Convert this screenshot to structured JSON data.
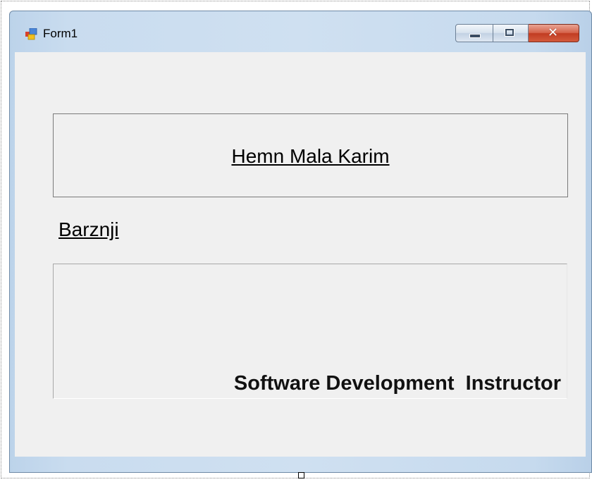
{
  "window": {
    "title": "Form1",
    "icon": "form-app-icon",
    "controls": {
      "minimize": "minimize-icon",
      "maximize": "maximize-icon",
      "close": "close-icon"
    }
  },
  "form": {
    "name_label": "Hemn Mala Karim",
    "surname_label": "Barznji",
    "role_text": "Software Development  Instructor"
  },
  "colors": {
    "client_bg": "#f0f0f0",
    "frame": "#c9dcef",
    "close_button": "#c13c22"
  }
}
